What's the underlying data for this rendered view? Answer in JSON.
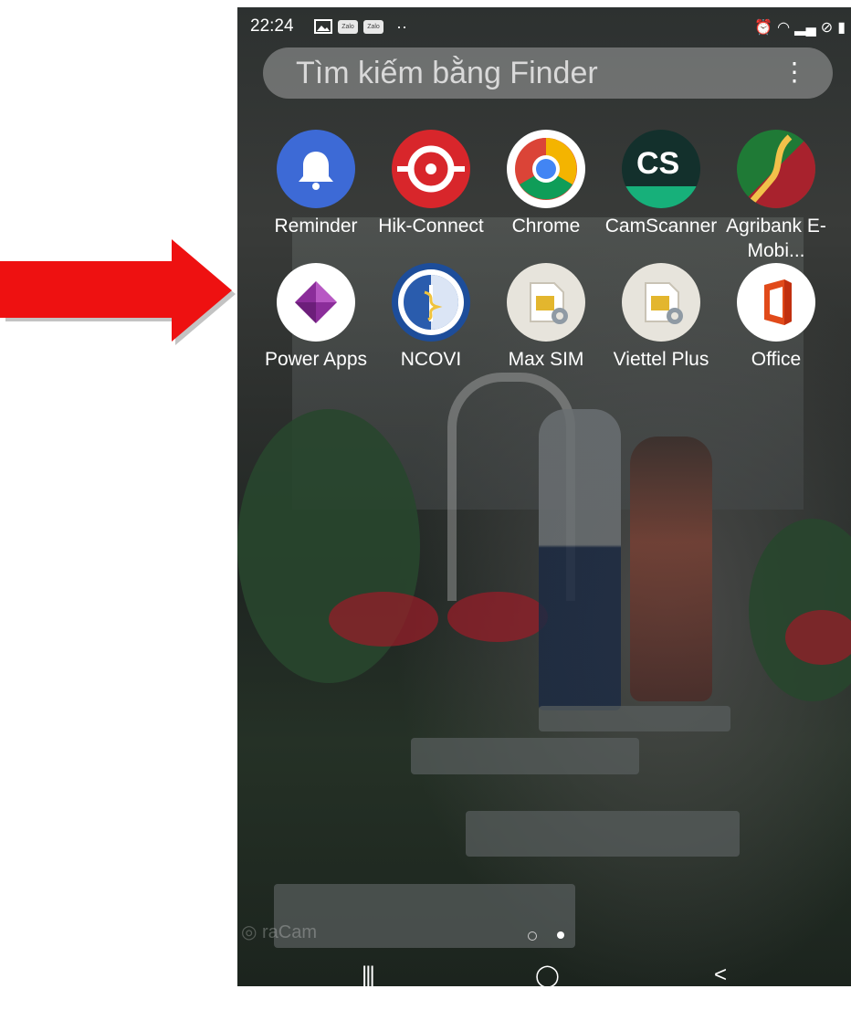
{
  "status": {
    "time": "22:24",
    "icons": [
      "gallery-icon",
      "zalo-icon",
      "zalo-icon",
      "more-dots-icon",
      "alarm-icon",
      "wifi-icon",
      "signal-icon",
      "dnd-icon",
      "battery-icon"
    ],
    "zalo_label": "Zalo",
    "more_dots": "··"
  },
  "search": {
    "placeholder": "Tìm kiếm bằng Finder",
    "more_icon": "⋮"
  },
  "apps": [
    {
      "label": "Reminder",
      "icon": "bell-icon",
      "color": "#3d6ad6"
    },
    {
      "label": "Hik-Connect",
      "icon": "hik-icon",
      "color": "#d8262b"
    },
    {
      "label": "Chrome",
      "icon": "chrome-icon",
      "color": "#ffffff"
    },
    {
      "label": "CamScanner",
      "icon": "camscanner-icon",
      "color": "#13302c",
      "text": "CS"
    },
    {
      "label": "Agribank E-Mobi...",
      "icon": "agribank-icon",
      "color": "#1f7a36"
    },
    {
      "label": "Power Apps",
      "icon": "powerapps-icon",
      "color": "#ffffff"
    },
    {
      "label": "NCOVI",
      "icon": "ncovi-icon",
      "color": "#1d4d9a"
    },
    {
      "label": "Max SIM",
      "icon": "sim-settings-icon",
      "color": "#e7e4dc"
    },
    {
      "label": "Viettel Plus",
      "icon": "sim-settings-icon",
      "color": "#e7e4dc"
    },
    {
      "label": "Office",
      "icon": "office-icon",
      "color": "#ffffff"
    }
  ],
  "pager": {
    "pages": 2,
    "current": 2
  },
  "nav": {
    "recent": "|||",
    "home": "◯",
    "back": "<"
  },
  "colors": {
    "arrow": "#ee1111",
    "accent": "#ffffff"
  }
}
